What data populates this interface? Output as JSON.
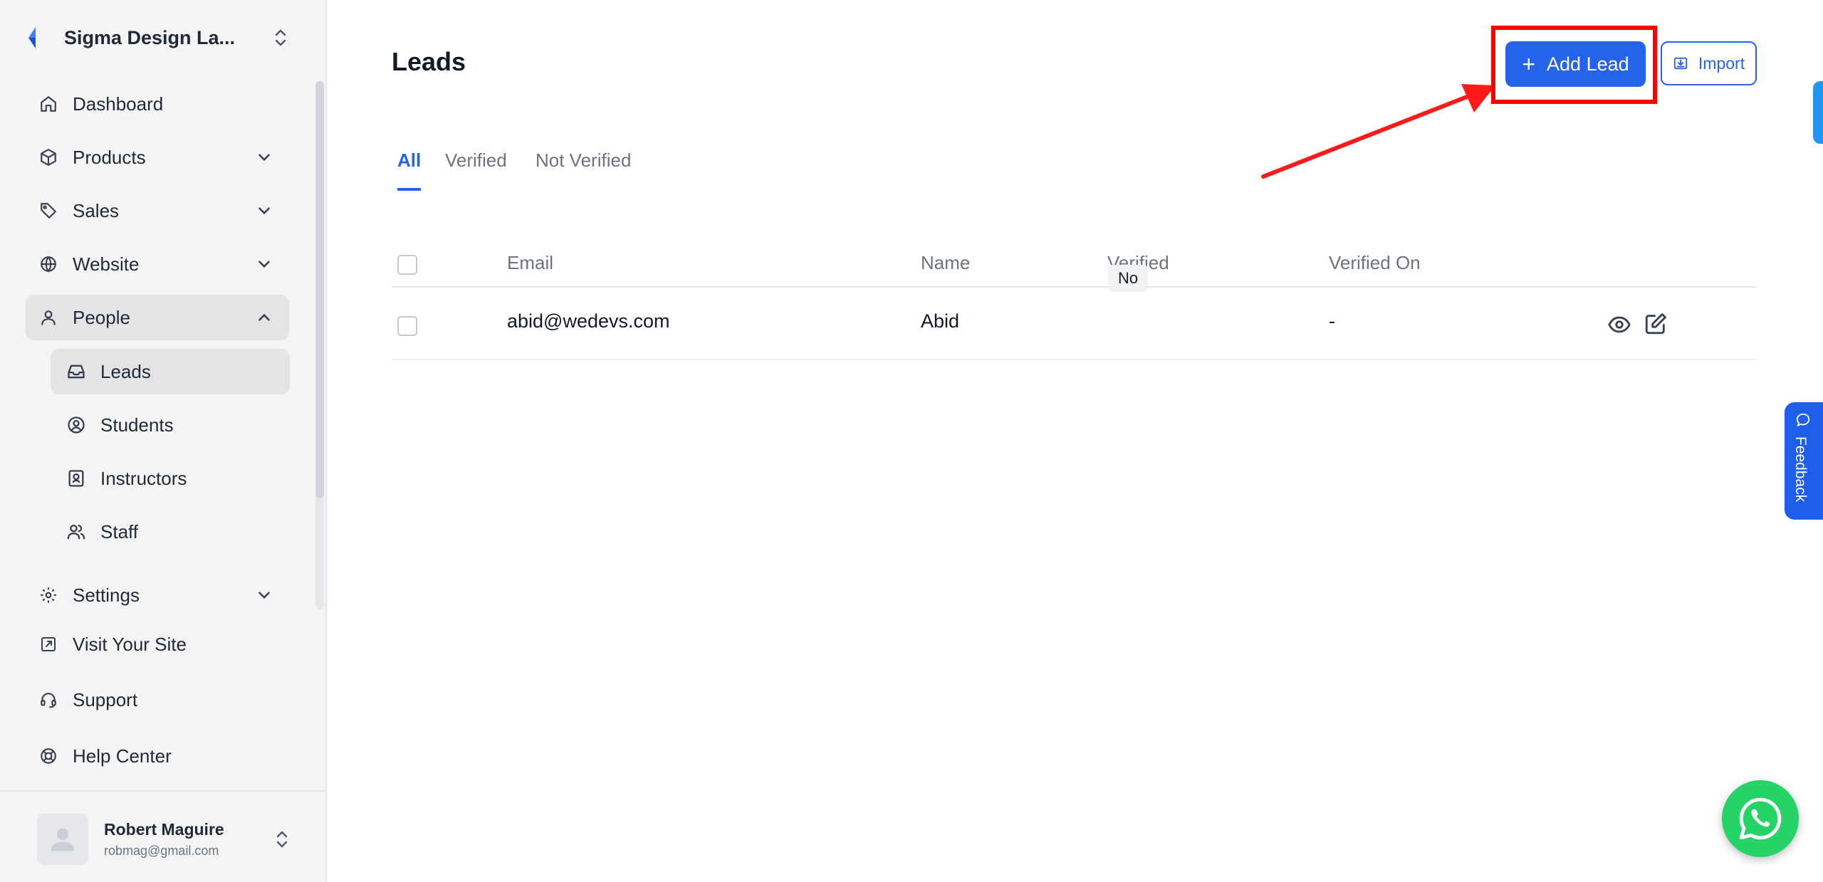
{
  "brand": {
    "name": "Sigma Design La...",
    "accent": "#2563eb"
  },
  "sidebar": {
    "items": [
      {
        "label": "Dashboard",
        "icon": "home-icon"
      },
      {
        "label": "Products",
        "icon": "box-icon"
      },
      {
        "label": "Sales",
        "icon": "tag-icon"
      },
      {
        "label": "Website",
        "icon": "globe-icon"
      },
      {
        "label": "People",
        "icon": "user-icon",
        "expanded": true
      },
      {
        "label": "Settings",
        "icon": "gear-icon"
      },
      {
        "label": "Visit Your Site",
        "icon": "external-link-icon"
      },
      {
        "label": "Support",
        "icon": "headset-icon"
      },
      {
        "label": "Help Center",
        "icon": "lifebuoy-icon"
      }
    ],
    "people_sub": [
      {
        "label": "Leads",
        "icon": "inbox-icon",
        "active": true
      },
      {
        "label": "Students",
        "icon": "user-circle-icon"
      },
      {
        "label": "Instructors",
        "icon": "id-badge-icon"
      },
      {
        "label": "Staff",
        "icon": "users-icon"
      }
    ]
  },
  "user": {
    "name": "Robert Maguire",
    "email": "robmag@gmail.com"
  },
  "main": {
    "title": "Leads",
    "add_label": "Add Lead",
    "import_label": "Import",
    "tabs": [
      "All",
      "Verified",
      "Not Verified"
    ],
    "active_tab": "All",
    "columns": [
      "Email",
      "Name",
      "Verified",
      "Verified On"
    ],
    "rows": [
      {
        "email": "abid@wedevs.com",
        "name": "Abid",
        "verified": "No",
        "verified_on": "-"
      }
    ]
  },
  "feedback_label": "Feedback",
  "colors": {
    "primary": "#2563eb",
    "highlight": "#ff0000",
    "whatsapp": "#25d366"
  }
}
